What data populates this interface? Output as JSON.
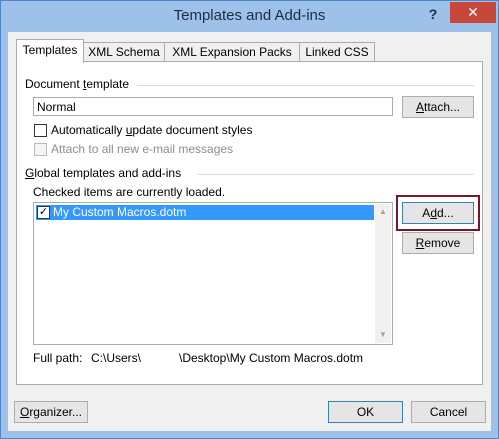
{
  "window": {
    "title": "Templates and Add-ins",
    "help_label": "?",
    "close_label": "✕"
  },
  "tabs": [
    {
      "label": "Templates",
      "active": true
    },
    {
      "label": "XML Schema",
      "active": false
    },
    {
      "label": "XML Expansion Packs",
      "active": false
    },
    {
      "label": "Linked CSS",
      "active": false
    }
  ],
  "document_template": {
    "group_label_pre": "Document ",
    "group_label_accel": "t",
    "group_label_post": "emplate",
    "value": "Normal",
    "attach_label_accel": "A",
    "attach_label_rest": "ttach...",
    "auto_update_pre": "Automatically ",
    "auto_update_accel": "u",
    "auto_update_post": "pdate document styles",
    "auto_update_checked": false,
    "attach_email_label": "Attach to all new e-mail messages",
    "attach_email_checked": false
  },
  "global_templates": {
    "group_label_accel": "G",
    "group_label_rest": "lobal templates and add-ins",
    "hint": "Checked items are currently loaded.",
    "items": [
      {
        "label": "My Custom Macros.dotm",
        "checked": true,
        "selected": true
      }
    ],
    "add_label_pre": "A",
    "add_label_accel": "d",
    "add_label_post": "d...",
    "remove_label_accel": "R",
    "remove_label_rest": "emove",
    "full_path_label": "Full path:",
    "full_path_part1": "C:\\Users\\",
    "full_path_part2": "\\Desktop\\My Custom Macros.dotm"
  },
  "footer": {
    "organizer_accel": "O",
    "organizer_rest": "rganizer...",
    "ok_label": "OK",
    "cancel_label": "Cancel"
  },
  "colors": {
    "title_bar": "#9dc1e9",
    "close_button": "#c7473b",
    "selection": "#3399ff",
    "annotation_box": "#7a1628"
  }
}
